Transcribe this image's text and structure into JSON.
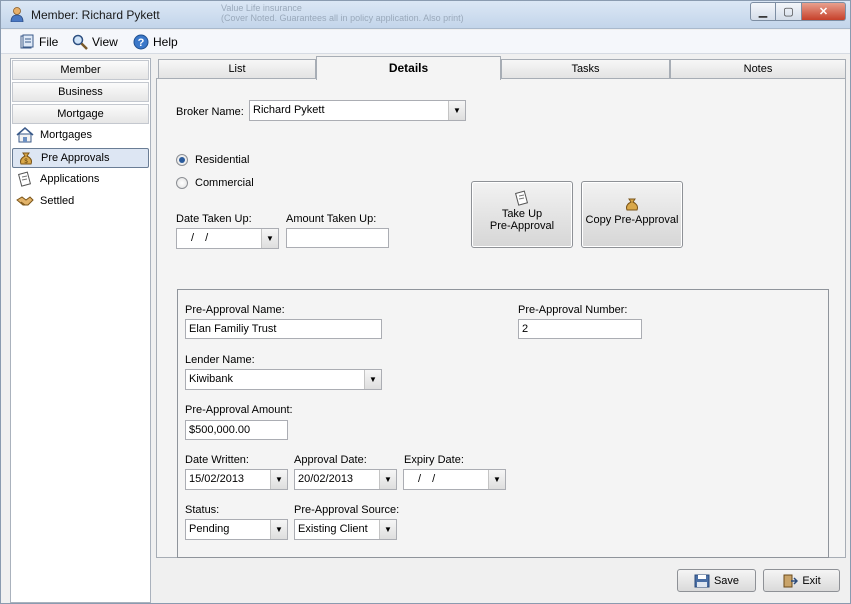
{
  "window": {
    "title": "Member: Richard Pykett",
    "background_text": [
      "Value Life insurance",
      "(Cover Noted. Guarantees all in policy application. Also print)"
    ]
  },
  "menu": {
    "file": "File",
    "view": "View",
    "help": "Help"
  },
  "sidebar": {
    "tabs": [
      "Member",
      "Business",
      "Mortgage"
    ],
    "items": [
      {
        "label": "Mortgages",
        "icon": "house-icon"
      },
      {
        "label": "Pre Approvals",
        "icon": "money-bag-icon",
        "selected": true
      },
      {
        "label": "Applications",
        "icon": "scroll-icon"
      },
      {
        "label": "Settled",
        "icon": "handshake-icon"
      }
    ]
  },
  "tabs": [
    "List",
    "Details",
    "Tasks",
    "Notes"
  ],
  "active_tab": "Details",
  "form": {
    "broker_label": "Broker Name:",
    "broker_value": "Richard Pykett",
    "radio_residential": "Residential",
    "radio_commercial": "Commercial",
    "selected_type": "Residential",
    "date_taken_up_label": "Date Taken Up:",
    "date_taken_up_value": "/ /",
    "amount_taken_up_label": "Amount Taken Up:",
    "amount_taken_up_value": "",
    "take_up_button": [
      "Take Up",
      "Pre-Approval"
    ],
    "copy_button": "Copy Pre-Approval",
    "preapproval_name_label": "Pre-Approval Name:",
    "preapproval_name_value": "Elan Familiy Trust",
    "preapproval_number_label": "Pre-Approval Number:",
    "preapproval_number_value": "2",
    "lender_label": "Lender Name:",
    "lender_value": "Kiwibank",
    "amount_label": "Pre-Approval Amount:",
    "amount_value": "$500,000.00",
    "date_written_label": "Date Written:",
    "date_written_value": "15/02/2013",
    "approval_date_label": "Approval Date:",
    "approval_date_value": "20/02/2013",
    "expiry_date_label": "Expiry Date:",
    "expiry_date_value": "/ /",
    "status_label": "Status:",
    "status_value": "Pending",
    "source_label": "Pre-Approval Source:",
    "source_value": "Existing Client"
  },
  "footer": {
    "save": "Save",
    "exit": "Exit"
  },
  "colors": {
    "accent": "#2a5b9c",
    "close_button": "#c6402a"
  }
}
